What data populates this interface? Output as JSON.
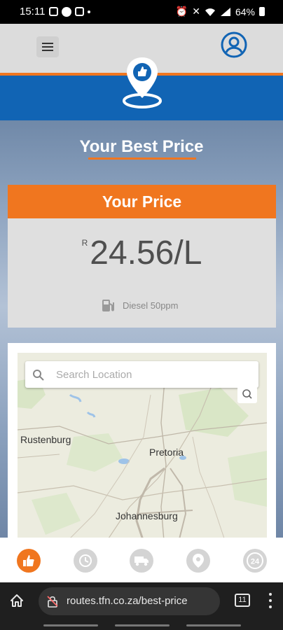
{
  "status_bar": {
    "time": "15:11",
    "battery": "64%"
  },
  "page": {
    "title": "Your Best Price"
  },
  "price_card": {
    "header": "Your Price",
    "currency": "R",
    "price": "24.56/L",
    "fuel_type": "Diesel 50ppm"
  },
  "map": {
    "search_placeholder": "Search Location",
    "cities": {
      "rustenburg": "Rustenburg",
      "pretoria": "Pretoria",
      "johannesburg": "Johannesburg"
    }
  },
  "bottom_nav": {
    "items": [
      {
        "icon": "thumbs-up-icon",
        "active": true
      },
      {
        "icon": "clock-icon",
        "active": false
      },
      {
        "icon": "truck-icon",
        "active": false
      },
      {
        "icon": "location-pin-icon",
        "active": false
      },
      {
        "icon": "24-hours-icon",
        "active": false,
        "label": "24"
      }
    ]
  },
  "browser": {
    "url": "routes.tfn.co.za/best-price",
    "tab_count": "11"
  },
  "colors": {
    "accent_orange": "#f0761f",
    "brand_blue": "#1164b4"
  }
}
